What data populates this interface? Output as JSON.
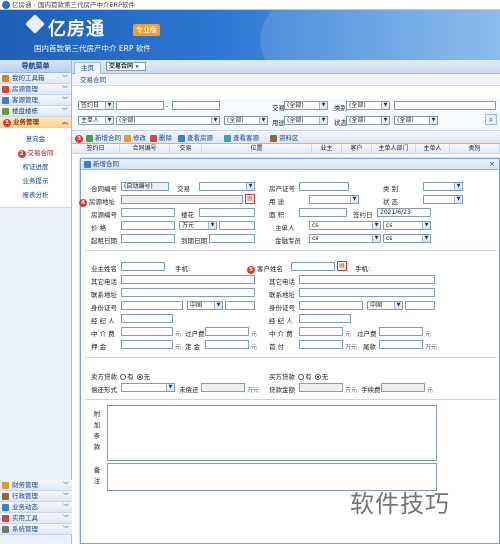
{
  "window": {
    "title": "亿房通 - 国内首款第三代房产中介ERP软件"
  },
  "banner": {
    "brand": "亿房通",
    "edition": "专业版",
    "slogan": "国内首款第三代房产中介 ERP 软件"
  },
  "sidebar": {
    "header": "导航菜单",
    "top_items": [
      {
        "label": "我的工具箱",
        "color": "#d9822b"
      },
      {
        "label": "房源管理",
        "color": "#c94a3d"
      },
      {
        "label": "客源管理",
        "color": "#3d7fc9"
      },
      {
        "label": "楼盘楼栋",
        "color": "#6a9a3d"
      }
    ],
    "business": {
      "badge": "1",
      "label": "业务管理"
    },
    "sub_items": [
      "意向金",
      "交易合同",
      "权证进度",
      "业务提示",
      "报表分析"
    ],
    "sub_badge": "2",
    "bottom_items": [
      {
        "label": "财务管理",
        "color": "#d9a02b"
      },
      {
        "label": "行政管理",
        "color": "#8a6a3d"
      },
      {
        "label": "业务动态",
        "color": "#3d7fc9"
      },
      {
        "label": "实用工具",
        "color": "#c94a3d"
      },
      {
        "label": "系统管理",
        "color": "#777777"
      }
    ]
  },
  "tabs": {
    "home": "主页",
    "contract": "交易合同"
  },
  "page_title": "交易合同",
  "filter": {
    "date_field": "签约日",
    "range_sep": "-",
    "trade_label": "交易",
    "trade_value": "(全部)",
    "category_label": "类别",
    "category_value": "(全部)",
    "party_field": "主单人",
    "party_value": "(全部)",
    "sel3": "(全部)",
    "use_label": "用途",
    "use_value": "(全部)",
    "status_label": "状态",
    "status_value": "(全部)",
    "sel6": "(全部)"
  },
  "toolbar": {
    "badge": "3",
    "add": "新增合同",
    "edit": "修改",
    "del": "删除",
    "view_house": "查看房源",
    "view_client": "查看客源",
    "info": "资料区"
  },
  "grid_headers": [
    "签约日",
    "合同编号",
    "交易",
    "位置",
    "业主",
    "客户",
    "主单人部门",
    "主单人",
    "类别"
  ],
  "dialog": {
    "title": "新增合同",
    "contract_no_label": "合同编号",
    "contract_no_value": "(自动编号)",
    "trade_label": "交易",
    "cert_label": "房产证号",
    "category_label": "类 别",
    "badge4": "4",
    "house_addr_label": "房源地址",
    "use_label": "用 途",
    "status_label": "状 态",
    "house_no_label": "房源编号",
    "floor_label": "楼花",
    "area_label": "面 积",
    "sign_date_label": "签约日",
    "sign_date_value": "2021/6/23",
    "price_label": "价 格",
    "price_unit": "万元",
    "main_person_label": "主单人",
    "main_person_value": "cs",
    "main_person_value2": "cs",
    "start_date_label": "起租日期",
    "due_date_label": "到期日期",
    "finance_label": "金融专员",
    "finance_value": "cs",
    "finance_value2": "cs",
    "owner_label": "业主姓名",
    "owner_phone": "手机:",
    "badge5": "5",
    "client_label": "客户姓名",
    "client_phone": "手机:",
    "other_phone": "其它电话",
    "contact_addr": "联系地址",
    "id_label": "身份证号",
    "id_country": "中国",
    "agent_label": "经 纪 人",
    "agency_fee": "中 介 费",
    "agency_unit": "元",
    "transfer_fee": "过户费",
    "transfer_unit": "元",
    "deposit_label": "押 金",
    "deposit_unit": "元",
    "down_label": "定 金",
    "down_unit": "元",
    "first_pay": "首 付",
    "first_unit": "万元",
    "tail_label": "尾款",
    "tail_unit": "万元",
    "seller_loan_label": "卖方贷款",
    "yes": "有",
    "no": "无",
    "buyer_loan_label": "买方贷款",
    "repay_label": "偿还形式",
    "unpaid_label": "未偿还",
    "unpaid_unit": "万元",
    "loan_amount_label": "贷款金额",
    "loan_unit": "万元",
    "handling_fee_label": "手续费",
    "handling_unit": "元",
    "attach_label": "附 加 条 款",
    "remark_label": "备 注"
  },
  "watermark": "软件技巧"
}
